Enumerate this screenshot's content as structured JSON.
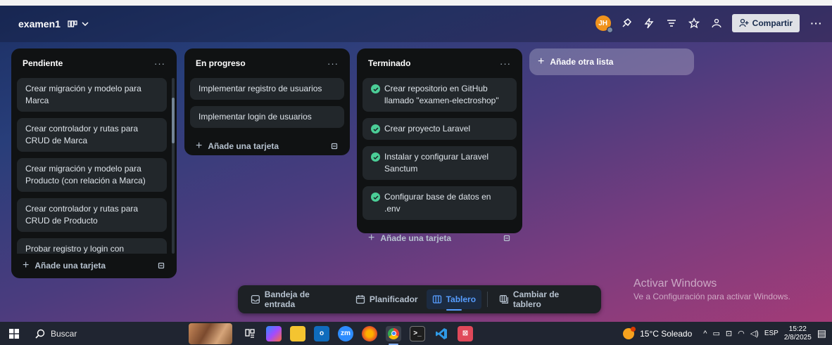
{
  "header": {
    "board_title": "examen1",
    "view_icon": "table-view-icon",
    "avatar_initials": "JH",
    "share_label": "Compartir",
    "more_label": "···"
  },
  "lists": [
    {
      "title": "Pendiente",
      "menu": "···",
      "cards": [
        "Crear migración y modelo para Marca",
        "Crear controlador y rutas para CRUD de Marca",
        "Crear migración y modelo para Producto (con relación a Marca)",
        "Crear controlador y rutas para CRUD de Producto",
        "Probar registro y login con"
      ],
      "add_label": "Añade una tarjeta"
    },
    {
      "title": "En progreso",
      "menu": "···",
      "cards": [
        "Implementar registro de usuarios",
        "Implementar login de usuarios"
      ],
      "add_label": "Añade una tarjeta"
    },
    {
      "title": "Terminado",
      "menu": "···",
      "cards": [
        "Crear repositorio en GitHub llamado \"examen-electroshop\"",
        "Crear proyecto Laravel",
        "Instalar y configurar Laravel Sanctum",
        "Configurar base de datos en .env"
      ],
      "add_label": "Añade una tarjeta"
    }
  ],
  "add_list_label": "Añade otra lista",
  "bottom_bar": {
    "inbox": "Bandeja de entrada",
    "planner": "Planificador",
    "board": "Tablero",
    "switch_board": "Cambiar de tablero"
  },
  "watermark": {
    "line1": "Activar Windows",
    "line2": "Ve a Configuración para activar Windows."
  },
  "taskbar": {
    "search_label": "Buscar",
    "weather": "15°C Soleado",
    "language": "ESP",
    "time": "15:22",
    "date": "2/8/2025"
  },
  "colors": {
    "list_bg": "#101213",
    "card_bg": "#22272b",
    "done_check": "#4bce97",
    "active_tab": "#579dff",
    "avatar": "#f0931d"
  }
}
